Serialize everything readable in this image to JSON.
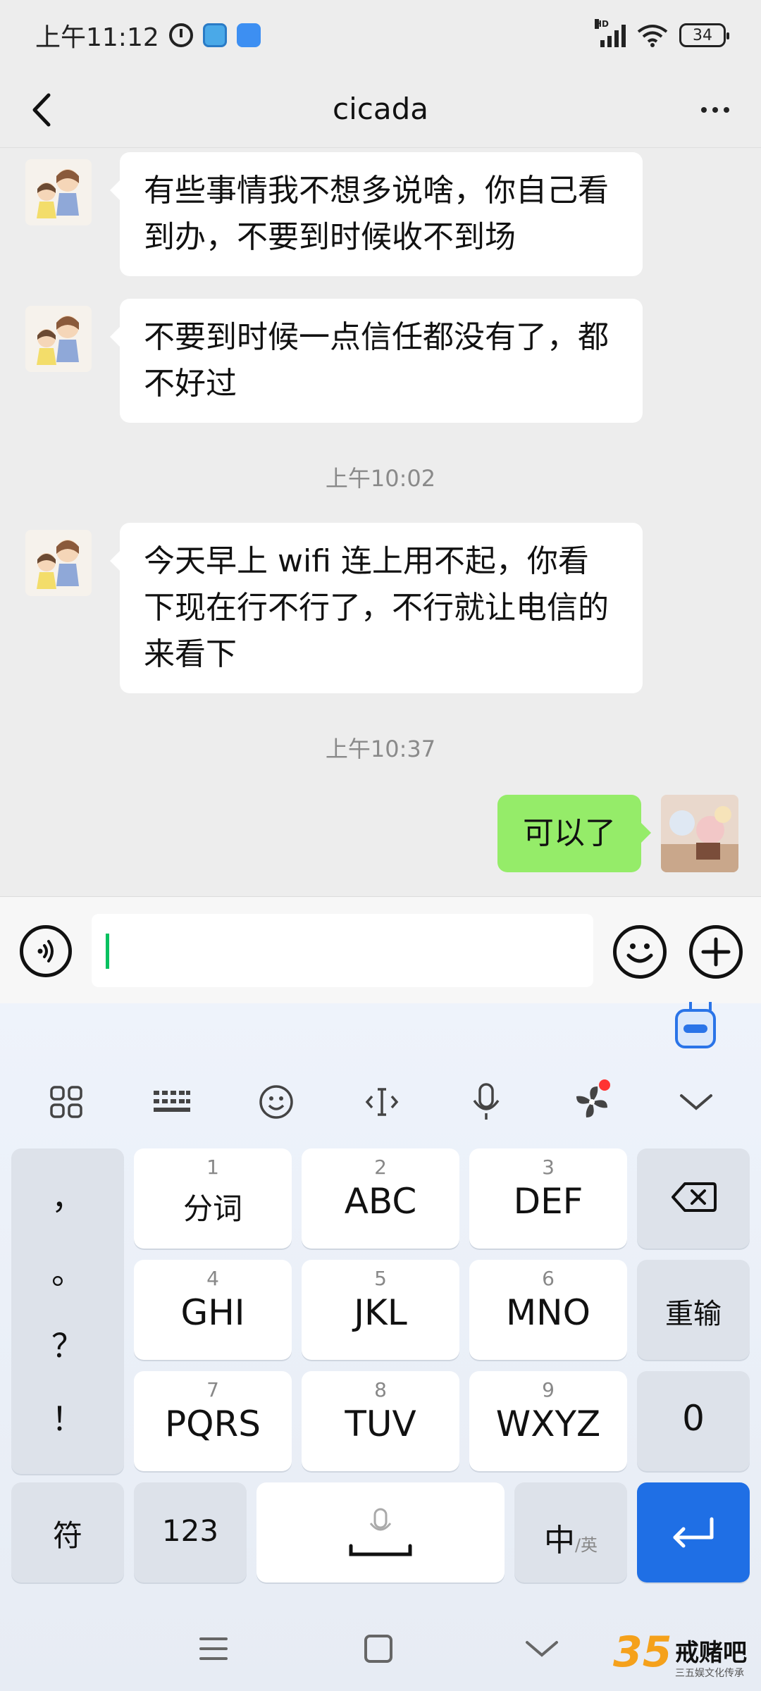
{
  "status_bar": {
    "time": "上午11:12",
    "network": "HD",
    "battery": "34"
  },
  "header": {
    "title": "cicada"
  },
  "messages": [
    {
      "direction": "in",
      "text_lines": [
        "有些事情我不想多说啥，你自己看",
        "到办，不要到时候收不到场"
      ]
    },
    {
      "direction": "in",
      "text_lines": [
        "不要到时候一点信任都没有了，都",
        "不好过"
      ]
    },
    {
      "type": "time",
      "text": "上午10:02"
    },
    {
      "direction": "in",
      "text_lines": [
        "今天早上 wifi 连上用不起，你看",
        "下现在行不行了，不行就让电信的",
        "来看下"
      ]
    },
    {
      "type": "time",
      "text": "上午10:37"
    },
    {
      "direction": "out",
      "text": "可以了"
    }
  ],
  "input": {
    "value": ""
  },
  "keyboard": {
    "punctuation": [
      "，",
      "。",
      "？",
      "！"
    ],
    "keys": [
      {
        "num": "1",
        "label": "分词"
      },
      {
        "num": "2",
        "label": "ABC"
      },
      {
        "num": "3",
        "label": "DEF"
      },
      {
        "num": "4",
        "label": "GHI"
      },
      {
        "num": "5",
        "label": "JKL"
      },
      {
        "num": "6",
        "label": "MNO"
      },
      {
        "num": "7",
        "label": "PQRS"
      },
      {
        "num": "8",
        "label": "TUV"
      },
      {
        "num": "9",
        "label": "WXYZ"
      }
    ],
    "reinput": "重输",
    "zero": "0",
    "symbols": "符",
    "numbers": "123",
    "lang_main": "中",
    "lang_alt": "/英"
  },
  "watermark": {
    "number": "35",
    "name": "戒赌吧",
    "sub": "三五娱文化传承"
  },
  "colors": {
    "outgoing_bubble": "#95ec69",
    "incoming_bubble": "#ffffff",
    "chat_bg": "#ededed",
    "caret": "#07c160",
    "enter_key": "#1f6fe5"
  }
}
